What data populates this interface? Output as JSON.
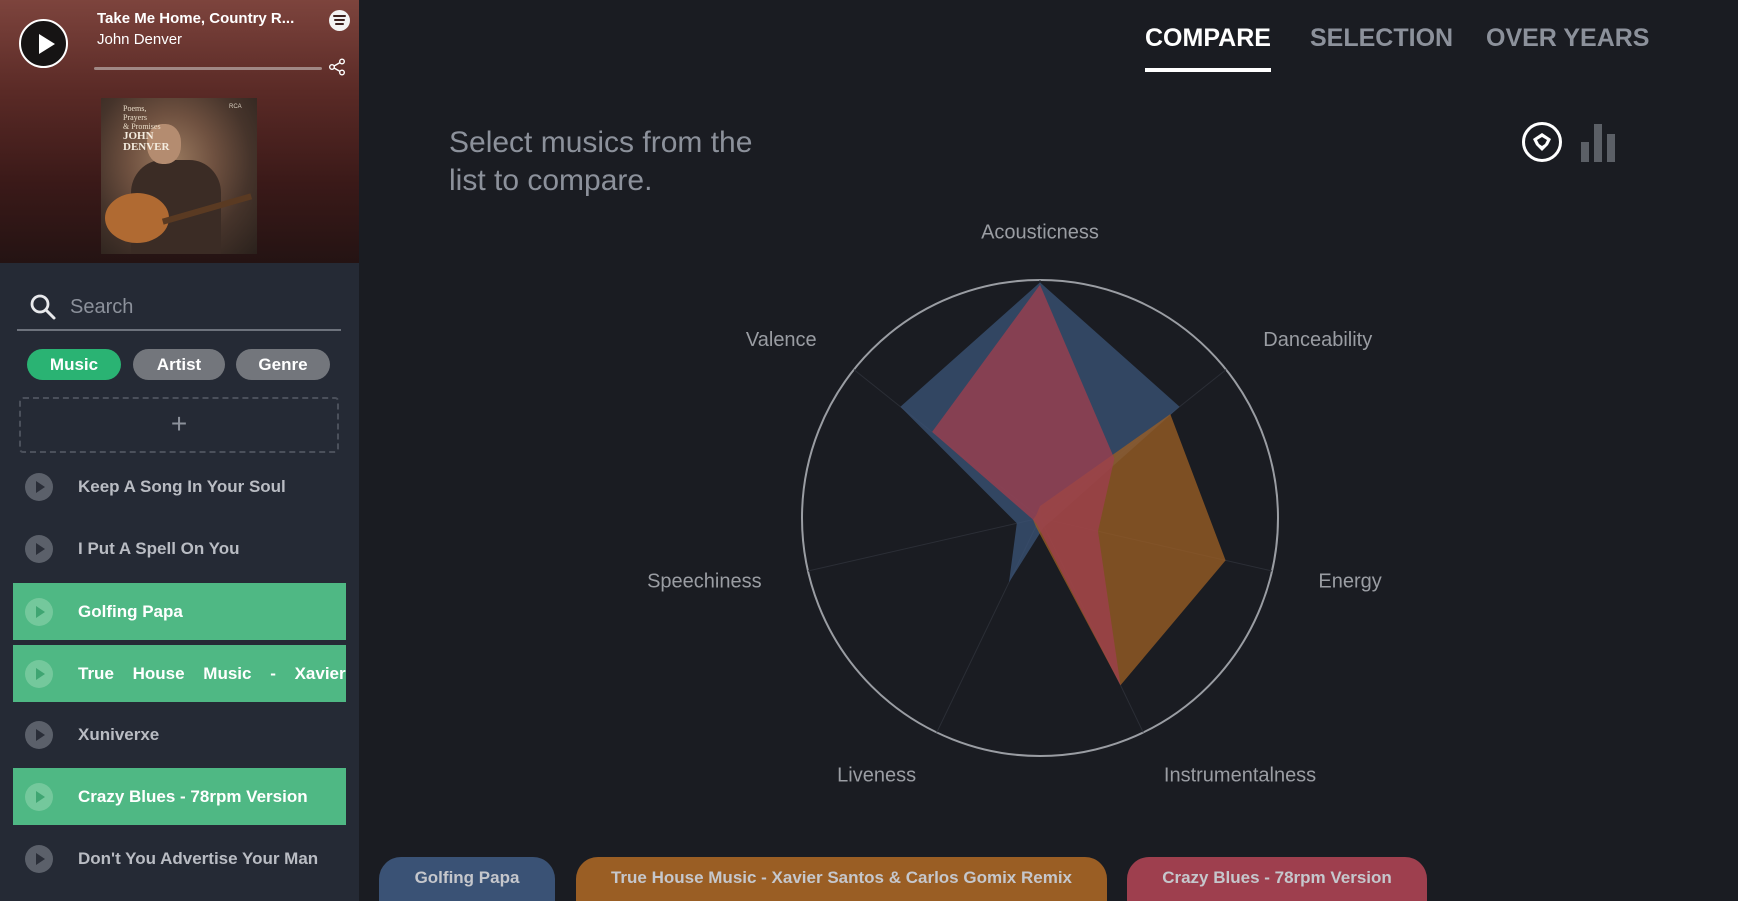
{
  "player": {
    "title": "Take Me Home, Country R...",
    "artist": "John Denver",
    "album_art_text": [
      "Poems,",
      "Prayers",
      "& Promises"
    ],
    "album_art_artist": "JOHN DENVER",
    "album_art_label": "RCA"
  },
  "search": {
    "placeholder": "Search"
  },
  "filters": [
    {
      "label": "Music",
      "active": true
    },
    {
      "label": "Artist",
      "active": false
    },
    {
      "label": "Genre",
      "active": false
    }
  ],
  "add_label": "+",
  "tracks": [
    {
      "name": "Keep A Song In Your Soul",
      "selected": false
    },
    {
      "name": "I Put A Spell On You",
      "selected": false
    },
    {
      "name": "Golfing Papa",
      "selected": true
    },
    {
      "name": "True House Music - Xavier Santos & Carlos Gomix Remix",
      "selected": true
    },
    {
      "name": "Xuniverxe",
      "selected": false
    },
    {
      "name": "Crazy Blues - 78rpm Version",
      "selected": true
    },
    {
      "name": "Don't You Advertise Your Man",
      "selected": false
    }
  ],
  "tabs": [
    {
      "label": "COMPARE",
      "active": true
    },
    {
      "label": "SELECTION",
      "active": false
    },
    {
      "label": "OVER YEARS",
      "active": false
    }
  ],
  "hint": "Select musics from the list to compare.",
  "view_toggle": {
    "radar_icon": "radar-chart-icon",
    "bar_icon": "bar-chart-icon",
    "active": "radar"
  },
  "colors": {
    "accent": "#2ab373",
    "series": [
      "#3a5275",
      "#9a5e24",
      "#9e3f4e"
    ]
  },
  "chart_data": {
    "type": "radar",
    "axes": [
      "Acousticness",
      "Danceability",
      "Energy",
      "Instrumentalness",
      "Liveness",
      "Speechiness",
      "Valence"
    ],
    "range": [
      0,
      1
    ],
    "series": [
      {
        "name": "Golfing Papa",
        "values": [
          0.99,
          0.75,
          0.05,
          0.04,
          0.3,
          0.1,
          0.75
        ]
      },
      {
        "name": "True House Music - Xavier Santos & Carlos Gomix Remix",
        "values": [
          0.05,
          0.7,
          0.8,
          0.78,
          0.04,
          0.03,
          0.02
        ]
      },
      {
        "name": "Crazy Blues - 78rpm Version",
        "values": [
          0.98,
          0.4,
          0.25,
          0.78,
          0.03,
          0.03,
          0.58
        ]
      }
    ]
  }
}
